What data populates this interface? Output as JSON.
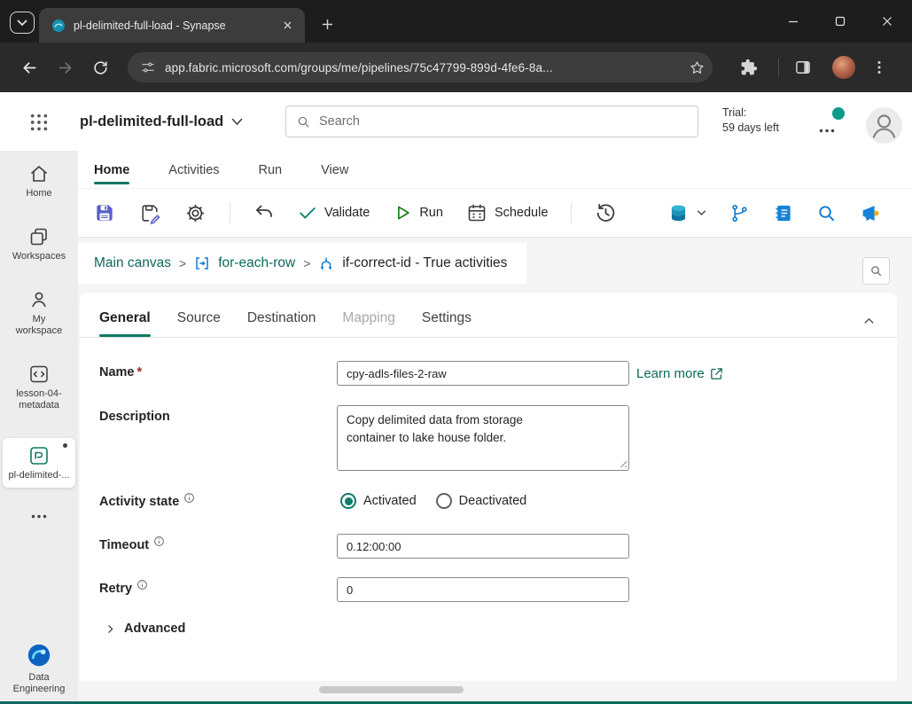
{
  "colors": {
    "accent_teal": "#117865",
    "link_teal": "#0c695a",
    "run_green": "#107c10",
    "save_purple": "#5a5fc7",
    "icon_blue": "#0e7ad3",
    "presence_dot": "#0f9989"
  },
  "browser": {
    "tab_title": "pl-delimited-full-load - Synapse",
    "url": "app.fabric.microsoft.com/groups/me/pipelines/75c47799-899d-4fe6-8a..."
  },
  "app_header": {
    "title": "pl-delimited-full-load",
    "search_placeholder": "Search",
    "trial_label": "Trial:",
    "trial_remaining": "59 days left"
  },
  "sidebar": {
    "items": [
      {
        "label": "Home"
      },
      {
        "label": "Workspaces"
      },
      {
        "label": "My workspace"
      },
      {
        "label": "lesson-04-metadata"
      },
      {
        "label": "pl-delimited-..."
      },
      {
        "label": "Data Engineering"
      }
    ]
  },
  "menu": {
    "tabs": [
      {
        "label": "Home"
      },
      {
        "label": "Activities"
      },
      {
        "label": "Run"
      },
      {
        "label": "View"
      }
    ]
  },
  "toolbar": {
    "validate_label": "Validate",
    "run_label": "Run",
    "schedule_label": "Schedule"
  },
  "breadcrumb": {
    "separator": ">",
    "items": [
      {
        "label": "Main canvas"
      },
      {
        "label": "for-each-row"
      },
      {
        "label": "if-correct-id - True activities"
      }
    ]
  },
  "panel": {
    "tabs": [
      {
        "label": "General"
      },
      {
        "label": "Source"
      },
      {
        "label": "Destination"
      },
      {
        "label": "Mapping"
      },
      {
        "label": "Settings"
      }
    ],
    "fields": {
      "name_label": "Name",
      "required_mark": "*",
      "name_value": "cpy-adls-files-2-raw",
      "learn_more_label": "Learn more",
      "description_label": "Description",
      "description_value": "Copy delimited data from storage\ncontainer to lake house folder.",
      "activity_state_label": "Activity state",
      "activated_label": "Activated",
      "deactivated_label": "Deactivated",
      "timeout_label": "Timeout",
      "timeout_value": "0.12:00:00",
      "retry_label": "Retry",
      "retry_value": "0",
      "advanced_label": "Advanced"
    }
  }
}
